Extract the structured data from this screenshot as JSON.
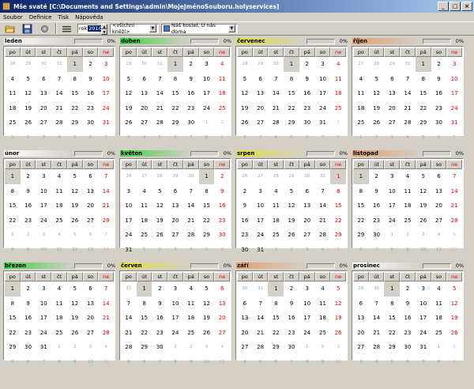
{
  "window": {
    "title": "Mše svaté [C:\\Documents and Settings\\admin\\MojeJménoSouboru.holyservices]"
  },
  "menu": [
    "Soubor",
    "Definice",
    "Tisk",
    "Nápověda"
  ],
  "toolbar": {
    "year_label": "rok",
    "year_value": "2010",
    "priest_select": "<všichni kněží>",
    "church_select": "Náš kostel, U nás doma",
    "church_color": "#3a78d8"
  },
  "weekday_headers": [
    "po",
    "út",
    "st",
    "čt",
    "pá",
    "so",
    "ne"
  ],
  "months": [
    {
      "name": "leden",
      "pct": "0%",
      "color": "#ffffff",
      "grid": [
        [
          28,
          29,
          30,
          31,
          1,
          2,
          3
        ],
        [
          4,
          5,
          6,
          7,
          8,
          9,
          10
        ],
        [
          11,
          12,
          13,
          14,
          15,
          16,
          17
        ],
        [
          18,
          19,
          20,
          21,
          22,
          23,
          24
        ],
        [
          25,
          26,
          27,
          28,
          29,
          30,
          31
        ],
        [
          1,
          2,
          3,
          4,
          5,
          6,
          7
        ]
      ],
      "first": 4,
      "count": 31,
      "hl": [
        4
      ]
    },
    {
      "name": "duben",
      "pct": "0%",
      "color": "#40d040",
      "grid": [
        [
          29,
          30,
          31,
          1,
          2,
          3,
          4
        ],
        [
          5,
          6,
          7,
          8,
          9,
          10,
          11
        ],
        [
          12,
          13,
          14,
          15,
          16,
          17,
          18
        ],
        [
          19,
          20,
          21,
          22,
          23,
          24,
          25
        ],
        [
          26,
          27,
          28,
          29,
          30,
          1,
          2
        ],
        [
          3,
          4,
          5,
          6,
          7,
          8,
          9
        ]
      ],
      "first": 3,
      "count": 30,
      "hl": [
        3
      ]
    },
    {
      "name": "červenec",
      "pct": "0%",
      "color": "#e0e040",
      "grid": [
        [
          28,
          29,
          30,
          1,
          2,
          3,
          4
        ],
        [
          5,
          6,
          7,
          8,
          9,
          10,
          11
        ],
        [
          12,
          13,
          14,
          15,
          16,
          17,
          18
        ],
        [
          19,
          20,
          21,
          22,
          23,
          24,
          25
        ],
        [
          26,
          27,
          28,
          29,
          30,
          31,
          1
        ],
        [
          2,
          3,
          4,
          5,
          6,
          7,
          8
        ]
      ],
      "first": 3,
      "count": 31,
      "hl": [
        3
      ]
    },
    {
      "name": "říjen",
      "pct": "0%",
      "color": "#e0a070",
      "grid": [
        [
          27,
          28,
          29,
          30,
          1,
          2,
          3
        ],
        [
          4,
          5,
          6,
          7,
          8,
          9,
          10
        ],
        [
          11,
          12,
          13,
          14,
          15,
          16,
          17
        ],
        [
          18,
          19,
          20,
          21,
          22,
          23,
          24
        ],
        [
          25,
          26,
          27,
          28,
          29,
          30,
          31
        ],
        [
          1,
          2,
          3,
          4,
          5,
          6,
          7
        ]
      ],
      "first": 4,
      "count": 31,
      "hl": [
        4
      ]
    },
    {
      "name": "únor",
      "pct": "0%",
      "color": "#ffffff",
      "grid": [
        [
          1,
          2,
          3,
          4,
          5,
          6,
          7
        ],
        [
          8,
          9,
          10,
          11,
          12,
          13,
          14
        ],
        [
          15,
          16,
          17,
          18,
          19,
          20,
          21
        ],
        [
          22,
          23,
          24,
          25,
          26,
          27,
          28
        ],
        [
          1,
          2,
          3,
          4,
          5,
          6,
          7
        ],
        [
          8,
          9,
          10,
          11,
          12,
          13,
          14
        ]
      ],
      "first": 0,
      "count": 28,
      "hl": [
        0
      ]
    },
    {
      "name": "květen",
      "pct": "0%",
      "color": "#40d040",
      "grid": [
        [
          26,
          27,
          28,
          29,
          30,
          1,
          2
        ],
        [
          3,
          4,
          5,
          6,
          7,
          8,
          9
        ],
        [
          10,
          11,
          12,
          13,
          14,
          15,
          16
        ],
        [
          17,
          18,
          19,
          20,
          21,
          22,
          23
        ],
        [
          24,
          25,
          26,
          27,
          28,
          29,
          30
        ],
        [
          31,
          1,
          2,
          3,
          4,
          5,
          6
        ]
      ],
      "first": 5,
      "count": 31,
      "hl": [
        5
      ]
    },
    {
      "name": "srpen",
      "pct": "0%",
      "color": "#e0e040",
      "grid": [
        [
          26,
          27,
          28,
          29,
          30,
          31,
          1
        ],
        [
          2,
          3,
          4,
          5,
          6,
          7,
          8
        ],
        [
          9,
          10,
          11,
          12,
          13,
          14,
          15
        ],
        [
          16,
          17,
          18,
          19,
          20,
          21,
          22
        ],
        [
          23,
          24,
          25,
          26,
          27,
          28,
          29
        ],
        [
          30,
          31,
          1,
          2,
          3,
          4,
          5
        ]
      ],
      "first": 6,
      "count": 31,
      "hl": [
        6
      ]
    },
    {
      "name": "listopad",
      "pct": "0%",
      "color": "#e0a070",
      "grid": [
        [
          1,
          2,
          3,
          4,
          5,
          6,
          7
        ],
        [
          8,
          9,
          10,
          11,
          12,
          13,
          14
        ],
        [
          15,
          16,
          17,
          18,
          19,
          20,
          21
        ],
        [
          22,
          23,
          24,
          25,
          26,
          27,
          28
        ],
        [
          29,
          30,
          1,
          2,
          3,
          4,
          5
        ],
        [
          6,
          7,
          8,
          9,
          10,
          11,
          12
        ]
      ],
      "first": 0,
      "count": 30,
      "hl": [
        0
      ]
    },
    {
      "name": "březen",
      "pct": "0%",
      "color": "#40d040",
      "grid": [
        [
          1,
          2,
          3,
          4,
          5,
          6,
          7
        ],
        [
          8,
          9,
          10,
          11,
          12,
          13,
          14
        ],
        [
          15,
          16,
          17,
          18,
          19,
          20,
          21
        ],
        [
          22,
          23,
          24,
          25,
          26,
          27,
          28
        ],
        [
          29,
          30,
          31,
          1,
          2,
          3,
          4
        ],
        [
          5,
          6,
          7,
          8,
          9,
          10,
          11
        ]
      ],
      "first": 0,
      "count": 31,
      "hl": [
        0
      ]
    },
    {
      "name": "červen",
      "pct": "0%",
      "color": "#e0e040",
      "grid": [
        [
          31,
          1,
          2,
          3,
          4,
          5,
          6
        ],
        [
          7,
          8,
          9,
          10,
          11,
          12,
          13
        ],
        [
          14,
          15,
          16,
          17,
          18,
          19,
          20
        ],
        [
          21,
          22,
          23,
          24,
          25,
          26,
          27
        ],
        [
          28,
          29,
          30,
          1,
          2,
          3,
          4
        ],
        [
          5,
          6,
          7,
          8,
          9,
          10,
          11
        ]
      ],
      "first": 1,
      "count": 30,
      "hl": [
        1
      ]
    },
    {
      "name": "září",
      "pct": "0%",
      "color": "#e0a070",
      "grid": [
        [
          30,
          31,
          1,
          2,
          3,
          4,
          5
        ],
        [
          6,
          7,
          8,
          9,
          10,
          11,
          12
        ],
        [
          13,
          14,
          15,
          16,
          17,
          18,
          19
        ],
        [
          20,
          21,
          22,
          23,
          24,
          25,
          26
        ],
        [
          27,
          28,
          29,
          30,
          1,
          2,
          3
        ],
        [
          4,
          5,
          6,
          7,
          8,
          9,
          10
        ]
      ],
      "first": 2,
      "count": 30,
      "hl": [
        2
      ]
    },
    {
      "name": "prosinec",
      "pct": "0%",
      "color": "#ffffff",
      "grid": [
        [
          29,
          30,
          1,
          2,
          3,
          4,
          5
        ],
        [
          6,
          7,
          8,
          9,
          10,
          11,
          12
        ],
        [
          13,
          14,
          15,
          16,
          17,
          18,
          19
        ],
        [
          20,
          21,
          22,
          23,
          24,
          25,
          26
        ],
        [
          27,
          28,
          29,
          30,
          31,
          1,
          2
        ],
        [
          3,
          4,
          5,
          6,
          7,
          8,
          9
        ]
      ],
      "first": 2,
      "count": 31,
      "hl": [
        2
      ]
    }
  ]
}
